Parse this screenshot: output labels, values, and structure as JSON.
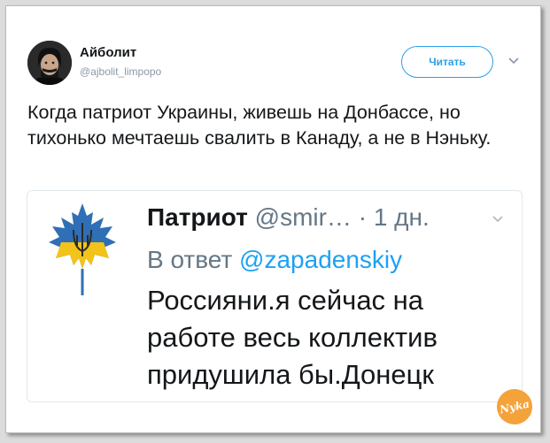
{
  "tweet": {
    "author_name": "Айболит",
    "author_handle": "@ajbolit_limpopo",
    "follow_label": "Читать",
    "text": "Когда патриот Украины, живешь на Донбассе, но тихонько мечтаешь свалить в Канаду, а не в Нэньку."
  },
  "quoted": {
    "author_name": "Патриот",
    "author_handle": "@smir…",
    "time": "· 1 дн.",
    "reply_prefix": "В ответ",
    "reply_mention": "@zapadenskiy",
    "text": "Россияни.я сейчас на работе весь коллектив придушила бы.Донецк"
  },
  "watermark": "Nyka",
  "icons": {
    "menu": "chevron-down-icon",
    "flag": "maple-leaf-trident-icon"
  },
  "colors": {
    "accent": "#2aa0e8",
    "mention": "#1da1f2",
    "muted": "#657786",
    "watermark": "#f4a23a"
  }
}
